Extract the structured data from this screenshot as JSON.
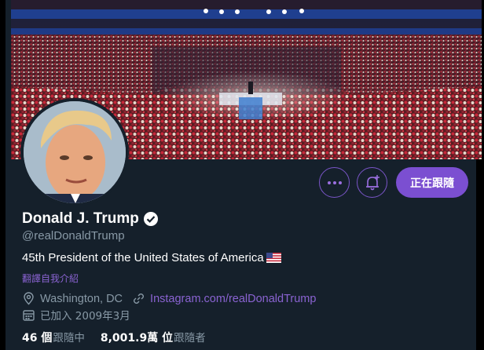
{
  "profile": {
    "display_name": "Donald J. Trump",
    "handle": "@realDonaldTrump",
    "bio": "45th President of the United States of America",
    "translate_label": "翻譯自我介紹",
    "location": "Washington, DC",
    "website": "Instagram.com/realDonaldTrump",
    "joined": "已加入 2009年3月"
  },
  "stats": {
    "following_count": "46 個",
    "following_label": "跟隨中",
    "followers_count": "8,001.9萬 位",
    "followers_label": "跟隨者"
  },
  "actions": {
    "follow_state_label": "正在跟隨"
  },
  "colors": {
    "background": "#15202b",
    "accent": "#7b4fd1",
    "secondary_text": "#8899a6"
  }
}
